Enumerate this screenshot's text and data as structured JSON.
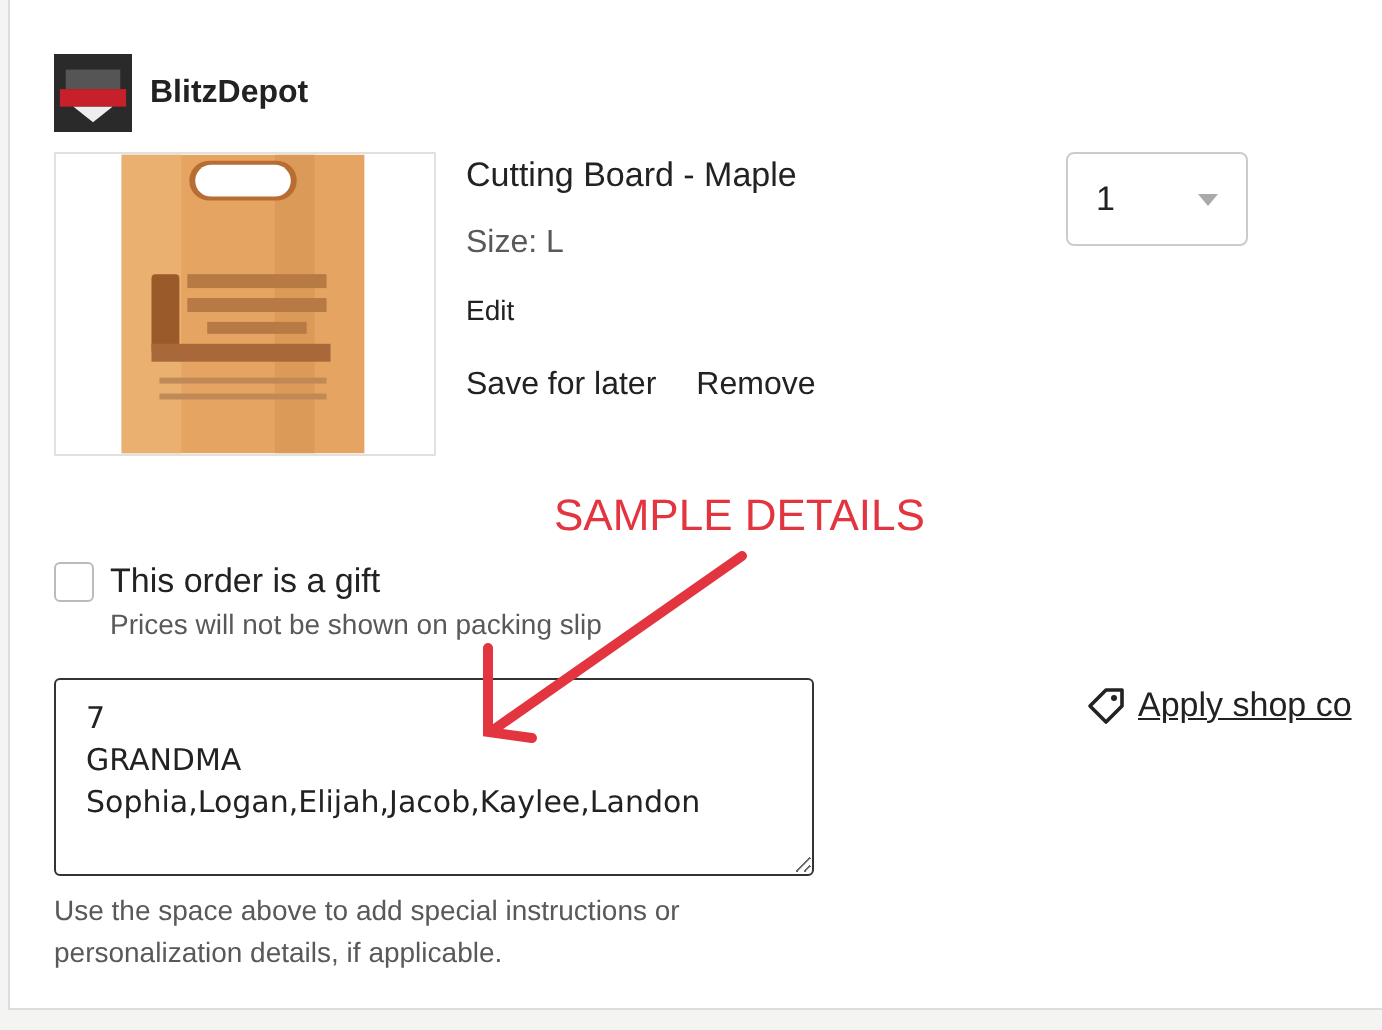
{
  "shop": {
    "name": "BlitzDepot"
  },
  "item": {
    "title": "Cutting Board - Maple",
    "variation": "Size: L",
    "edit": "Edit",
    "actions": [
      "Save for later",
      "Remove"
    ],
    "quantity": "1"
  },
  "annotation": {
    "label": "SAMPLE DETAILS"
  },
  "gift": {
    "checked": false,
    "label": "This order is a gift",
    "note": "Prices will not be shown on packing slip"
  },
  "personalization": {
    "value": "7\nGRANDMA\nSophia,Logan,Elijah,Jacob,Kaylee,Landon",
    "help": "Use the space above to add special instructions or personalization details, if applicable."
  },
  "coupon": {
    "label": "Apply shop co"
  }
}
